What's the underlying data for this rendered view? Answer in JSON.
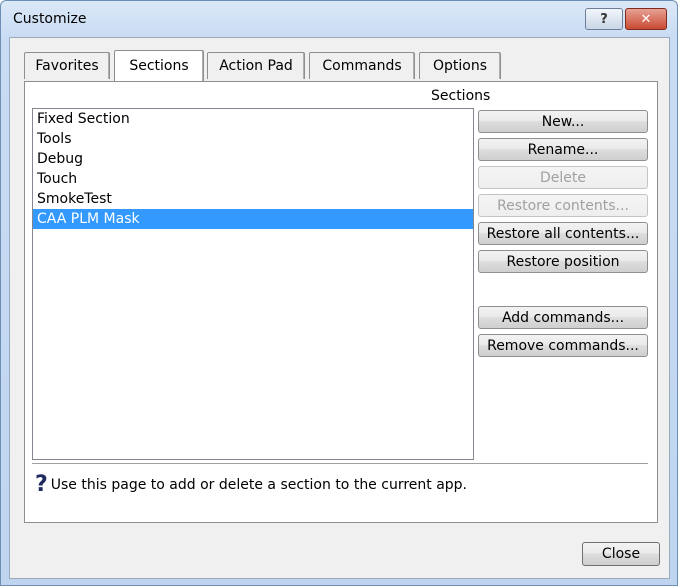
{
  "window": {
    "title": "Customize",
    "help_glyph": "?",
    "close_glyph": "✕"
  },
  "tabs": [
    "Favorites",
    "Sections",
    "Action Pad",
    "Commands",
    "Options"
  ],
  "active_tab": "Sections",
  "panel": {
    "list_label": "Sections",
    "items": [
      "Fixed Section",
      "Tools",
      "Debug",
      "Touch",
      "SmokeTest",
      "CAA PLM Mask"
    ],
    "selected_item": "CAA PLM Mask"
  },
  "buttons": {
    "new": "New...",
    "rename": "Rename...",
    "delete": "Delete",
    "restore_contents": "Restore contents...",
    "restore_all_contents": "Restore all contents...",
    "restore_position": "Restore position",
    "add_commands": "Add commands...",
    "remove_commands": "Remove commands..."
  },
  "help_text": "Use this page to add or delete a section to the current app.",
  "close_label": "Close"
}
